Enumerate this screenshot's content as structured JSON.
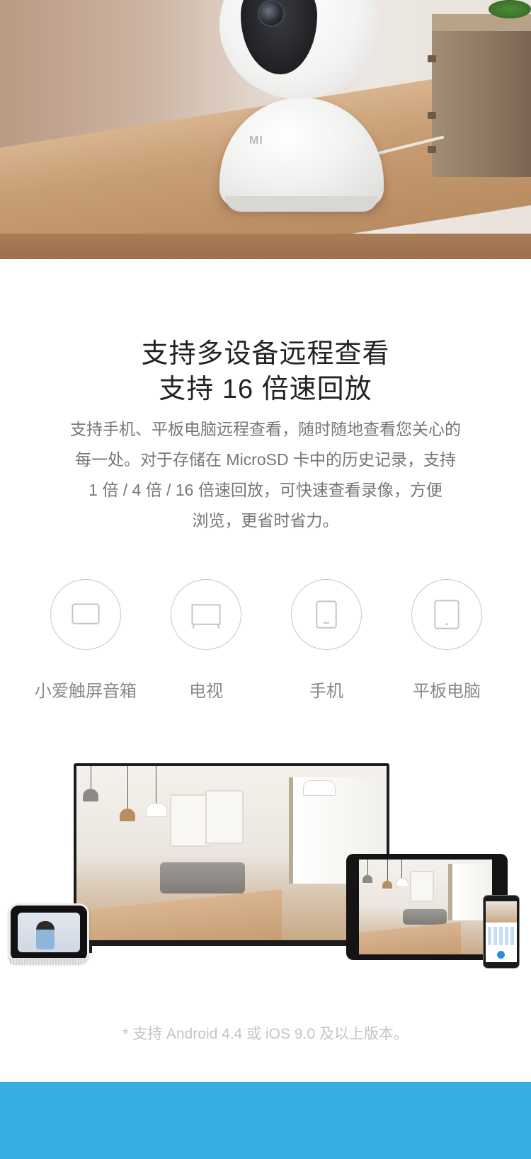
{
  "hero": {
    "camera_logo": "MI"
  },
  "headline": {
    "line1": "支持多设备远程查看",
    "line2": "支持 16 倍速回放"
  },
  "description": {
    "line1": "支持手机、平板电脑远程查看，随时随地查看您关心的",
    "line2": "每一处。对于存储在 MicroSD 卡中的历史记录，支持",
    "line3": "1 倍 / 4 倍 / 16 倍速回放，可快速查看录像，方便",
    "line4": "浏览，更省时省力。"
  },
  "devices": [
    {
      "label": "小爱触屏音箱",
      "icon": "smart-display-icon"
    },
    {
      "label": "电视",
      "icon": "tv-icon"
    },
    {
      "label": "手机",
      "icon": "phone-icon"
    },
    {
      "label": "平板电脑",
      "icon": "tablet-icon"
    }
  ],
  "footnote": "* 支持 Android 4.4 或 iOS 9.0 及以上版本。",
  "colors": {
    "footer_band": "#37ade2",
    "heading_text": "#222222",
    "body_text": "#777777",
    "icon_stroke": "#c8c8c8"
  }
}
